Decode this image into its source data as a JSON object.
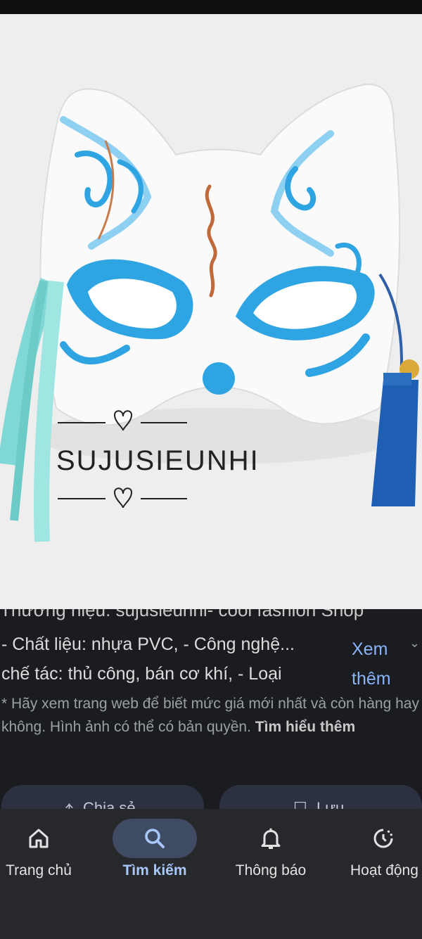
{
  "image": {
    "watermark": "SUJUSIEUNHI",
    "subject": "cat-mask"
  },
  "description": {
    "cut_line": "Thương hiệu: sujusieunhi- cool fashion Shop",
    "line1": "- Chất liệu: nhựa PVC, - Công nghệ...",
    "line2": "chế tác: thủ công, bán cơ khí, - Loại",
    "see_more_1": "Xem",
    "see_more_2": "thêm",
    "note": "* Hãy xem trang web để biết mức giá mới nhất và còn hàng hay không. Hình ảnh có thể có bản quyền.",
    "learn_more": "Tìm hiểu thêm"
  },
  "actions": {
    "share_label": "Chia sẻ",
    "save_label": "Lưu"
  },
  "nav": {
    "home": "Trang chủ",
    "search": "Tìm kiếm",
    "notifications": "Thông báo",
    "activity": "Hoạt động"
  },
  "colors": {
    "accent": "#a8c7fa",
    "link": "#8ab4f8",
    "mask_blue": "#2fa4e3",
    "ribbon": "#7fd8d6",
    "tassel": "#1f5fb3"
  }
}
